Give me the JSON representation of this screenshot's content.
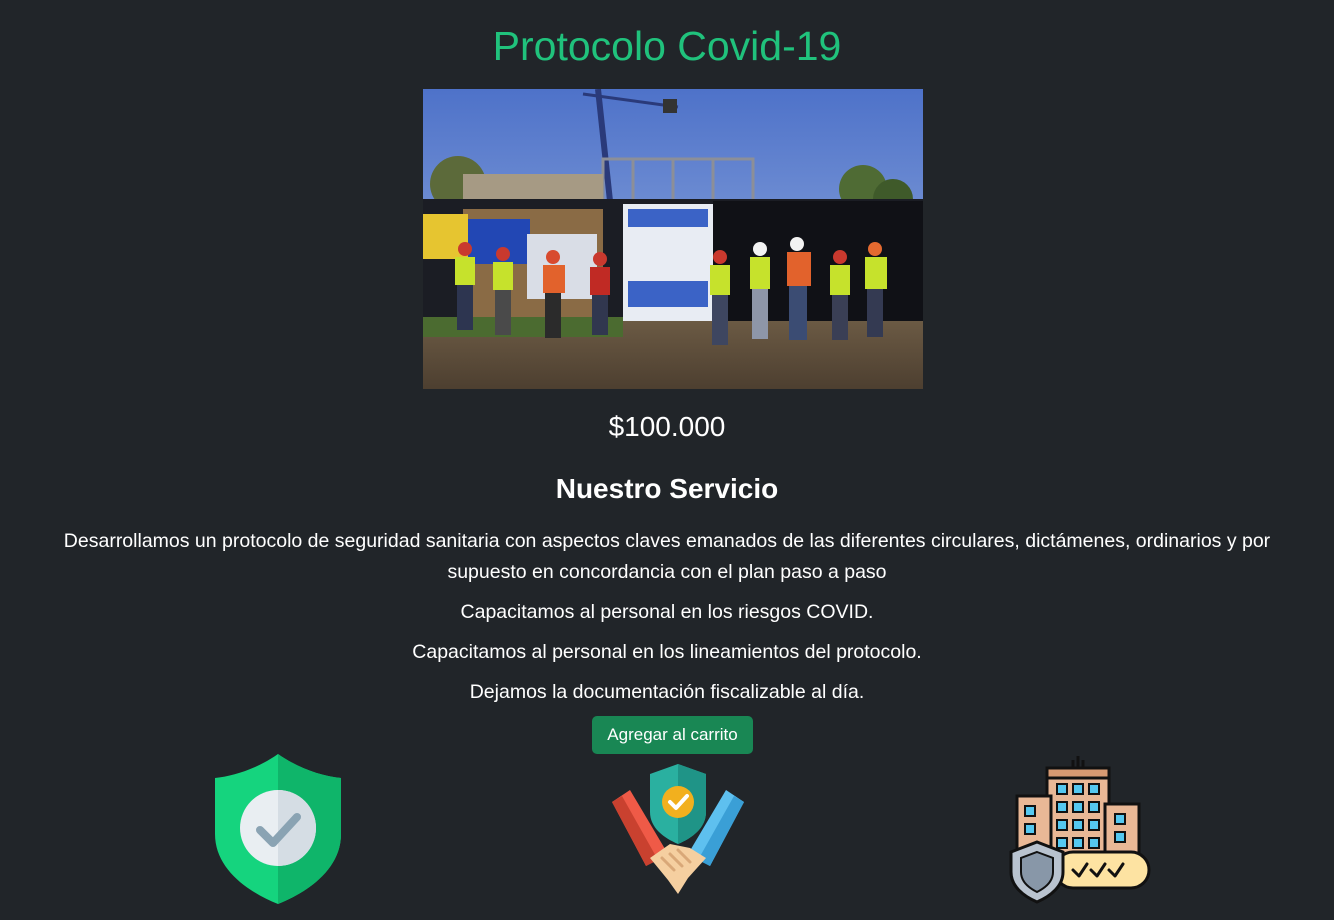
{
  "product": {
    "title": "Protocolo Covid-19",
    "image_alt": "Foto de equipo de trabajadores en obra de construcción",
    "price": "$100.000"
  },
  "service": {
    "heading": "Nuestro Servicio",
    "paragraphs": [
      "Desarrollamos un protocolo de seguridad sanitaria con aspectos claves emanados de las diferentes circulares, dictámenes, ordinarios y por supuesto en concordancia con el plan paso a paso",
      "Capacitamos al personal en los riesgos COVID.",
      "Capacitamos al personal en los lineamientos del protocolo.",
      "Dejamos la documentación fiscalizable al día."
    ]
  },
  "actions": {
    "add_to_cart_label": "Agregar al carrito"
  },
  "icons": [
    {
      "name": "shield-check-icon"
    },
    {
      "name": "handshake-shield-icon"
    },
    {
      "name": "secure-building-icon"
    }
  ],
  "colors": {
    "background": "#212529",
    "title": "#20c27c",
    "button": "#198754",
    "text": "#ffffff"
  }
}
